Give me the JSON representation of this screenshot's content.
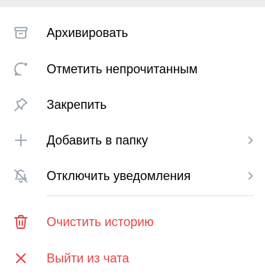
{
  "menu": {
    "items": [
      {
        "label": "Архивировать",
        "icon": "archive-icon"
      },
      {
        "label": "Отметить непрочитанным",
        "icon": "chat-unread-icon"
      },
      {
        "label": "Закрепить",
        "icon": "pin-icon"
      },
      {
        "label": "Добавить в папку",
        "icon": "plus-icon",
        "has_submenu": true
      },
      {
        "label": "Отключить уведомления",
        "icon": "bell-off-icon",
        "has_submenu": true
      }
    ],
    "danger_items": [
      {
        "label": "Очистить историю",
        "icon": "trash-icon"
      },
      {
        "label": "Выйти из чата",
        "icon": "close-icon"
      }
    ]
  },
  "colors": {
    "icon_gray": "#99a2ad",
    "danger": "#e64646",
    "divider": "#dce1e6",
    "text": "#000000"
  }
}
